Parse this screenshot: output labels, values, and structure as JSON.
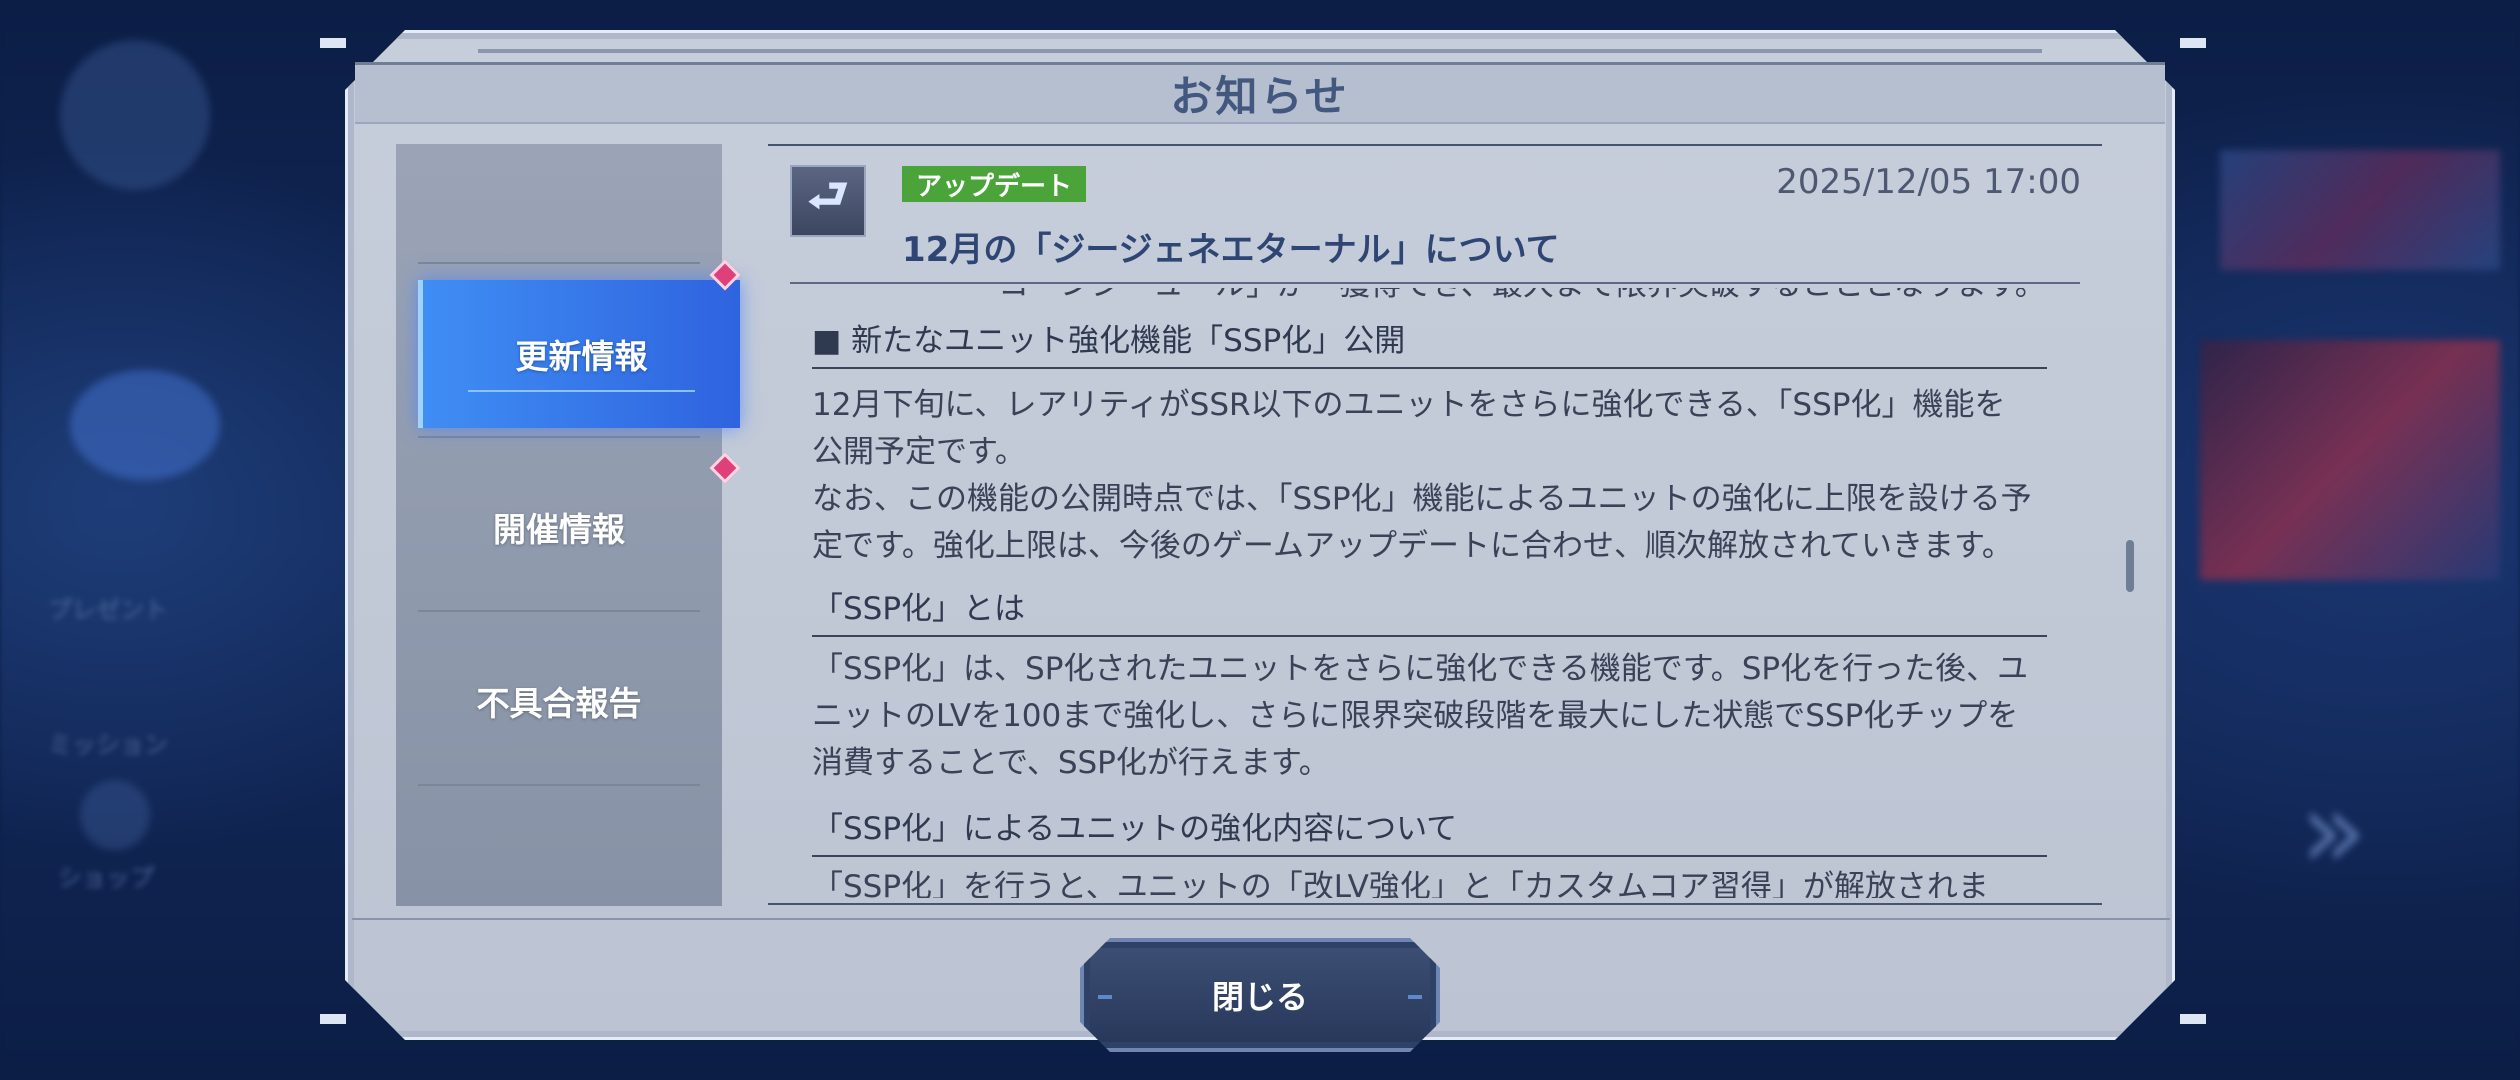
{
  "background": {
    "left_menu": [
      "プレゼント",
      "ミッション",
      "ショップ"
    ]
  },
  "modal": {
    "title": "お知らせ",
    "tabs": [
      {
        "label": "更新情報",
        "active": true,
        "badge": true
      },
      {
        "label": "開催情報",
        "active": false,
        "badge": true
      },
      {
        "label": "不具合報告",
        "active": false,
        "badge": false
      }
    ],
    "notice": {
      "category": "アップデート",
      "category_color": "#4aa43a",
      "date": "2025/12/05 17:00",
      "title": "12月の「ジージェネエターナル」について",
      "icon": "return-arrow-icon",
      "cut_top_line": "ー　ーーーーコ　ンジ　ュ　ル」が　獲得でき、最大まで限界突破することとなります。",
      "sections": [
        {
          "heading": "■ 新たなユニット強化機能「SSP化」公開",
          "lines": [
            "12月下旬に、レアリティがSSR以下のユニットをさらに強化できる、「SSP化」機能を",
            "公開予定です。",
            "なお、この機能の公開時点では、「SSP化」機能によるユニットの強化に上限を設ける予",
            "定です。強化上限は、今後のゲームアップデートに合わせ、順次解放されていきます。"
          ]
        },
        {
          "heading": "「SSP化」とは",
          "lines": [
            "「SSP化」は、SP化されたユニットをさらに強化できる機能です。SP化を行った後、ユ",
            "ニットのLVを100まで強化し、さらに限界突破段階を最大にした状態でSSP化チップを",
            "消費することで、SSP化が行えます。"
          ]
        },
        {
          "heading": "「SSP化」によるユニットの強化内容について",
          "lines": [
            "「SSP化」を行うと、ユニットの「改LV強化」と「カスタムコア習得」が解放されま"
          ]
        }
      ]
    },
    "close_label": "閉じる"
  },
  "colors": {
    "active_tab": "#3f8ef4",
    "badge": "#e0407a",
    "title": "#43587f"
  }
}
